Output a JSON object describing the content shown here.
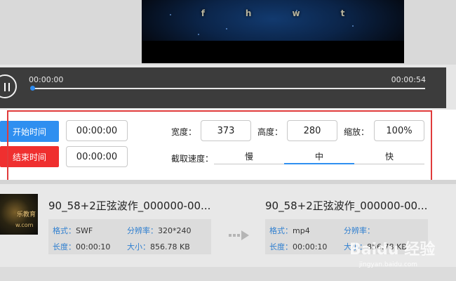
{
  "video": {
    "letters": [
      "f",
      "h",
      "w",
      "t"
    ]
  },
  "player": {
    "current_time": "00:00:00",
    "total_time": "00:00:54"
  },
  "settings": {
    "start_button": "开始时间",
    "end_button": "结束时间",
    "start_time": "00:00:00",
    "end_time": "00:00:00",
    "width_label": "宽度：",
    "width_value": "373",
    "height_label": "高度：",
    "height_value": "280",
    "scale_label": "缩放：",
    "scale_value": "100%",
    "speed_label": "截取速度：",
    "speed_options": [
      "慢",
      "中",
      "快"
    ],
    "speed_selected": "中"
  },
  "source_file": {
    "name": "90_58+2正弦波作_000000-00...",
    "format_key": "格式：",
    "format_value": "SWF",
    "resolution_key": "分辨率：",
    "resolution_value": "320*240",
    "duration_key": "长度：",
    "duration_value": "00:00:10",
    "size_key": "大小：",
    "size_value": "856.78 KB"
  },
  "output_file": {
    "name": "90_58+2正弦波作_000000-00...",
    "format_key": "格式：",
    "format_value": "mp4",
    "resolution_key": "分辨率：",
    "resolution_value": "",
    "duration_key": "长度：",
    "duration_value": "00:00:10",
    "size_key": "大小：",
    "size_value": "856.78 KB"
  },
  "thumb_text": {
    "line1": "乐教育",
    "line2": "w.com"
  },
  "watermark": {
    "brand": "Baidu 经验",
    "url": "jingyan.baidu.com"
  },
  "colors": {
    "accent_blue": "#2f8ff0",
    "accent_red": "#ef2f2f",
    "highlight_red": "#e03b3b"
  }
}
